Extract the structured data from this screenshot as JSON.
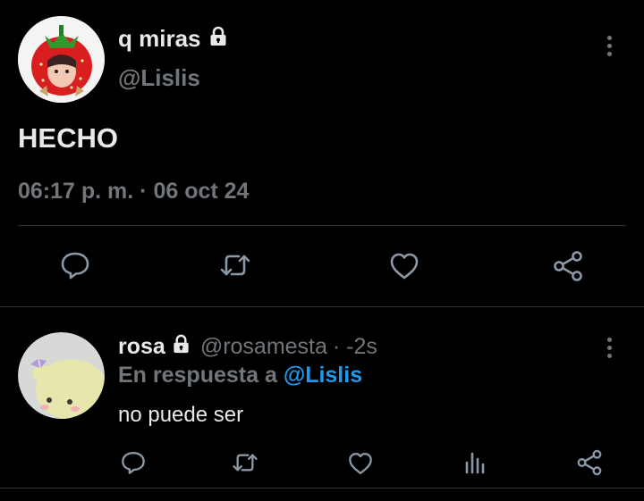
{
  "main_tweet": {
    "display_name": "q miras",
    "handle": "@Lislis",
    "text": "HECHO",
    "timestamp": "06:17 p. m. · 06 oct 24"
  },
  "reply": {
    "display_name": "rosa",
    "handle": "@rosamesta",
    "time": "· -2s",
    "replying_prefix": "En respuesta a",
    "replying_to": "@Lislis",
    "text": "no puede ser"
  },
  "colors": {
    "background": "#000000",
    "text": "#e7e9ea",
    "muted": "#71767b",
    "accent": "#1d9bf0",
    "divider": "#2f3336"
  },
  "icons": [
    "lock-icon",
    "more-icon",
    "reply-icon",
    "retweet-icon",
    "like-icon",
    "share-icon",
    "views-icon"
  ]
}
